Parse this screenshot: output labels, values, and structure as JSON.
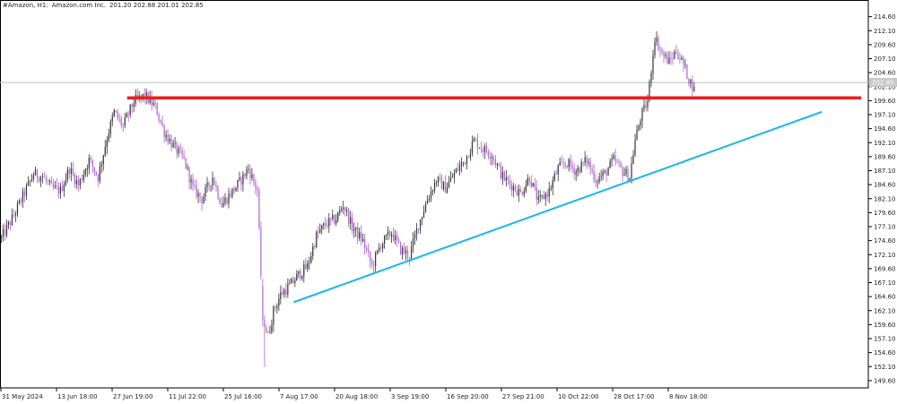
{
  "header": {
    "symbol": "#Amazon, H1:",
    "name": "Amazon.com Inc.",
    "ohlc": "201.20 202.88 201.01 202.85"
  },
  "colors": {
    "bull": "#333333",
    "bear": "#b061d0",
    "resistance": "#ee1c1c",
    "trendline": "#1ab6ea",
    "current_price_line": "#c0c0c0",
    "current_price_tag": "#c8c8c8"
  },
  "chart_data": {
    "type": "candlestick",
    "title": "",
    "xlabel": "",
    "ylabel": "",
    "ylim": [
      148.3,
      216.3
    ],
    "y_ticks": [
      "214.60",
      "212.10",
      "209.60",
      "207.10",
      "204.60",
      "202.10",
      "199.60",
      "197.10",
      "194.60",
      "192.10",
      "189.60",
      "187.10",
      "184.60",
      "182.10",
      "179.60",
      "177.10",
      "174.60",
      "172.10",
      "169.60",
      "167.10",
      "164.60",
      "162.10",
      "159.60",
      "157.10",
      "154.60",
      "152.10",
      "149.60"
    ],
    "x_ticks": [
      "31 May 2024",
      "13 Jun 18:00",
      "27 Jun 19:00",
      "11 Jul 22:00",
      "25 Jul 16:00",
      "7 Aug 17:00",
      "20 Aug 18:00",
      "3 Sep 19:00",
      "16 Sep 20:00",
      "27 Sep 21:00",
      "10 Oct 22:00",
      "28 Oct 17:00",
      "8 Nov 18:00"
    ],
    "current_price": 202.85,
    "current_price_label": "202.85",
    "price_path": [
      {
        "t": 0,
        "p": 175.0
      },
      {
        "t": 6,
        "p": 178.5
      },
      {
        "t": 12,
        "p": 182.5
      },
      {
        "t": 18,
        "p": 186.5
      },
      {
        "t": 23,
        "p": 186.0
      },
      {
        "t": 28,
        "p": 184.0
      },
      {
        "t": 33,
        "p": 183.5
      },
      {
        "t": 38,
        "p": 187.5
      },
      {
        "t": 43,
        "p": 184.5
      },
      {
        "t": 49,
        "p": 189.0
      },
      {
        "t": 54,
        "p": 186.0
      },
      {
        "t": 59,
        "p": 193.0
      },
      {
        "t": 63,
        "p": 197.5
      },
      {
        "t": 68,
        "p": 195.0
      },
      {
        "t": 74,
        "p": 199.5
      },
      {
        "t": 80,
        "p": 200.5
      },
      {
        "t": 86,
        "p": 198.5
      },
      {
        "t": 91,
        "p": 194.0
      },
      {
        "t": 96,
        "p": 191.5
      },
      {
        "t": 102,
        "p": 189.0
      },
      {
        "t": 107,
        "p": 184.0
      },
      {
        "t": 112,
        "p": 182.0
      },
      {
        "t": 118,
        "p": 186.0
      },
      {
        "t": 123,
        "p": 181.0
      },
      {
        "t": 128,
        "p": 183.0
      },
      {
        "t": 133,
        "p": 185.0
      },
      {
        "t": 138,
        "p": 187.5
      },
      {
        "t": 143,
        "p": 183.5
      },
      {
        "t": 146,
        "p": 161.0
      },
      {
        "t": 149,
        "p": 157.5
      },
      {
        "t": 152,
        "p": 162.0
      },
      {
        "t": 156,
        "p": 165.0
      },
      {
        "t": 161,
        "p": 166.5
      },
      {
        "t": 166,
        "p": 168.5
      },
      {
        "t": 171,
        "p": 170.0
      },
      {
        "t": 176,
        "p": 175.5
      },
      {
        "t": 181,
        "p": 177.5
      },
      {
        "t": 187,
        "p": 178.5
      },
      {
        "t": 191,
        "p": 181.0
      },
      {
        "t": 196,
        "p": 177.0
      },
      {
        "t": 202,
        "p": 174.5
      },
      {
        "t": 207,
        "p": 170.0
      },
      {
        "t": 212,
        "p": 174.0
      },
      {
        "t": 218,
        "p": 176.0
      },
      {
        "t": 223,
        "p": 173.0
      },
      {
        "t": 228,
        "p": 172.0
      },
      {
        "t": 233,
        "p": 177.5
      },
      {
        "t": 238,
        "p": 182.0
      },
      {
        "t": 243,
        "p": 185.5
      },
      {
        "t": 248,
        "p": 184.0
      },
      {
        "t": 254,
        "p": 187.0
      },
      {
        "t": 259,
        "p": 189.0
      },
      {
        "t": 264,
        "p": 192.5
      },
      {
        "t": 269,
        "p": 191.0
      },
      {
        "t": 274,
        "p": 190.0
      },
      {
        "t": 280,
        "p": 186.0
      },
      {
        "t": 285,
        "p": 184.5
      },
      {
        "t": 290,
        "p": 183.0
      },
      {
        "t": 295,
        "p": 186.0
      },
      {
        "t": 300,
        "p": 181.5
      },
      {
        "t": 306,
        "p": 183.5
      },
      {
        "t": 311,
        "p": 187.5
      },
      {
        "t": 316,
        "p": 188.5
      },
      {
        "t": 321,
        "p": 187.0
      },
      {
        "t": 327,
        "p": 189.0
      },
      {
        "t": 332,
        "p": 185.5
      },
      {
        "t": 337,
        "p": 186.5
      },
      {
        "t": 342,
        "p": 189.0
      },
      {
        "t": 347,
        "p": 187.0
      },
      {
        "t": 351,
        "p": 186.0
      },
      {
        "t": 354,
        "p": 192.5
      },
      {
        "t": 357,
        "p": 196.5
      },
      {
        "t": 361,
        "p": 199.5
      },
      {
        "t": 365,
        "p": 211.0
      },
      {
        "t": 369,
        "p": 208.0
      },
      {
        "t": 373,
        "p": 206.5
      },
      {
        "t": 377,
        "p": 208.5
      },
      {
        "t": 381,
        "p": 206.0
      },
      {
        "t": 384,
        "p": 203.5
      },
      {
        "t": 387,
        "p": 201.5
      }
    ],
    "annotations": [
      {
        "type": "horizontal_line",
        "name": "resistance",
        "price": 200.1,
        "t_start": 71,
        "t_end": 481
      },
      {
        "type": "trendline",
        "name": "rising-support",
        "points": [
          {
            "t": 164,
            "p": 163.6
          },
          {
            "t": 459,
            "p": 197.6
          }
        ]
      }
    ]
  }
}
